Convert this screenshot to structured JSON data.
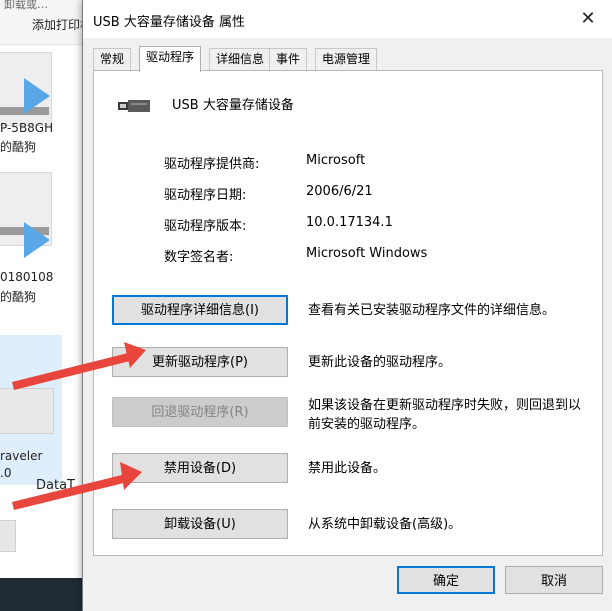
{
  "background_window": {
    "toolbar_top_text": "卸载或…",
    "toolbar_add_text": "添加打印机",
    "device1_label_line1": "P-5B8GH",
    "device1_label_line2": "的酷狗",
    "device2_label_line1": "0180108",
    "device2_label_line2": "的酷狗",
    "device3_label_line1": "raveler",
    "device3_label_line2": ".0",
    "device4_label": "DataT"
  },
  "dialog": {
    "title": "USB 大容量存储设备 属性",
    "close_glyph": "✕",
    "tabs": [
      {
        "label": "常规"
      },
      {
        "label": "驱动程序"
      },
      {
        "label": "详细信息"
      },
      {
        "label": "事件"
      },
      {
        "label": "电源管理"
      }
    ],
    "device_name": "USB 大容量存储设备",
    "info": [
      {
        "key": "驱动程序提供商:",
        "value": "Microsoft"
      },
      {
        "key": "驱动程序日期:",
        "value": "2006/6/21"
      },
      {
        "key": "驱动程序版本:",
        "value": "10.0.17134.1"
      },
      {
        "key": "数字签名者:",
        "value": "Microsoft Windows"
      }
    ],
    "actions": [
      {
        "button": "驱动程序详细信息(I)",
        "description": "查看有关已安装驱动程序文件的详细信息。"
      },
      {
        "button": "更新驱动程序(P)",
        "description": "更新此设备的驱动程序。"
      },
      {
        "button": "回退驱动程序(R)",
        "description": "如果该设备在更新驱动程序时失败，则回退到以前安装的驱动程序。"
      },
      {
        "button": "禁用设备(D)",
        "description": "禁用此设备。"
      },
      {
        "button": "卸载设备(U)",
        "description": "从系统中卸载设备(高级)。"
      }
    ],
    "ok_label": "确定",
    "cancel_label": "取消"
  },
  "colors": {
    "arrow": "#e8453c",
    "focus_border": "#0078d7",
    "play_icon": "#5aa7e8"
  }
}
